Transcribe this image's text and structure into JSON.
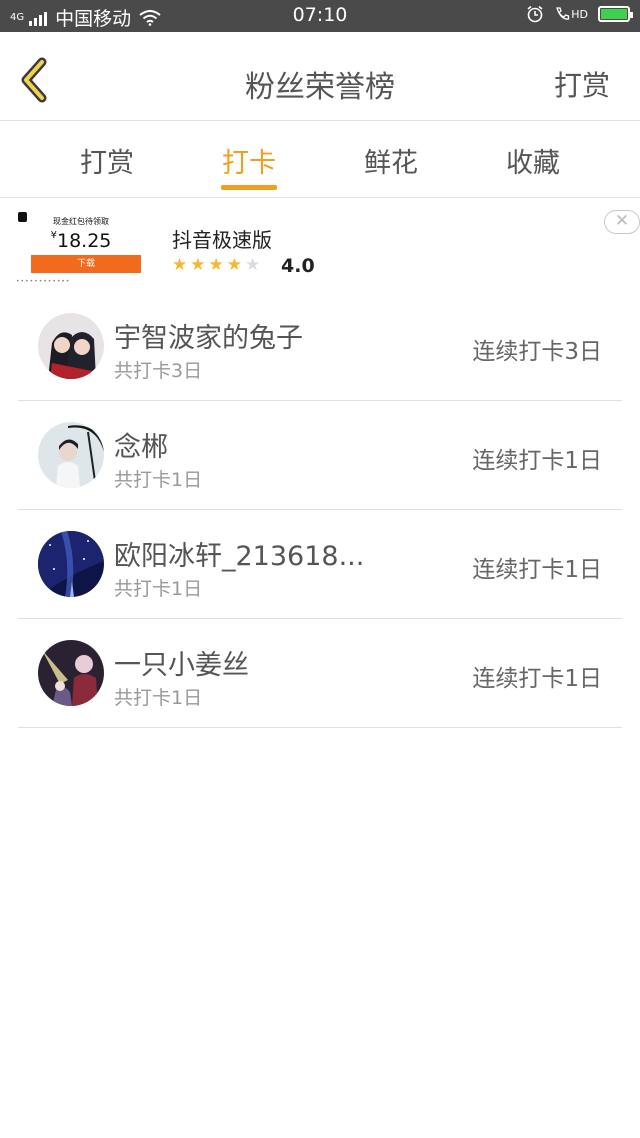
{
  "status_bar": {
    "network": "4G",
    "carrier": "中国移动",
    "time": "07:10",
    "hd": "HD"
  },
  "header": {
    "title": "粉丝荣誉榜",
    "right_action": "打赏"
  },
  "tabs": [
    {
      "label": "打赏",
      "active": false
    },
    {
      "label": "打卡",
      "active": true
    },
    {
      "label": "鲜花",
      "active": false
    },
    {
      "label": "收藏",
      "active": false
    }
  ],
  "ad": {
    "thumb_tag": "现金红包待领取",
    "thumb_currency": "¥",
    "thumb_price": "18.25",
    "thumb_button": "下载",
    "title": "抖音极速版",
    "rating": "4.0",
    "stars_filled": 4,
    "stars_total": 5,
    "close_glyph": "✕"
  },
  "list": [
    {
      "name": "宇智波家的兔子",
      "total": "共打卡3日",
      "streak": "连续打卡3日"
    },
    {
      "name": "念郴",
      "total": "共打卡1日",
      "streak": "连续打卡1日"
    },
    {
      "name": "欧阳冰轩_213618...",
      "total": "共打卡1日",
      "streak": "连续打卡1日"
    },
    {
      "name": "一只小姜丝",
      "total": "共打卡1日",
      "streak": "连续打卡1日"
    }
  ],
  "colors": {
    "accent": "#f0a020",
    "status_bar": "#4a4a4a",
    "ad_button": "#f26b1d",
    "star": "#f5b82e"
  },
  "icons": {
    "back": "back-chevron-icon",
    "close": "close-icon"
  }
}
